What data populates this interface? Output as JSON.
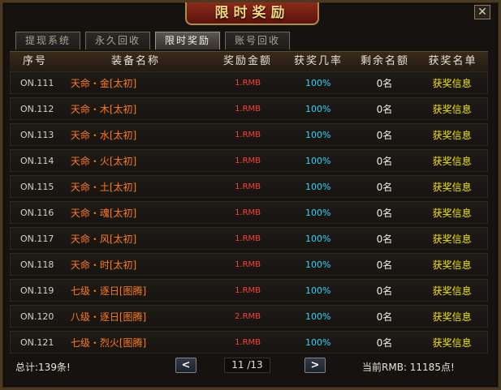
{
  "window": {
    "title": "限时奖励",
    "close_glyph": "✕"
  },
  "tabs": [
    {
      "label": "提现系统",
      "active": false
    },
    {
      "label": "永久回收",
      "active": false
    },
    {
      "label": "限时奖励",
      "active": true
    },
    {
      "label": "账号回收",
      "active": false
    }
  ],
  "table": {
    "headers": [
      "序号",
      "装备名称",
      "奖励金额",
      "获奖几率",
      "剩余名额",
      "获奖名单"
    ],
    "rows": [
      {
        "id": "ON.111",
        "name": "天命・金[太初]",
        "amount": "1.RMB",
        "rate": "100%",
        "remaining": "0名",
        "link": "获奖信息"
      },
      {
        "id": "ON.112",
        "name": "天命・木[太初]",
        "amount": "1.RMB",
        "rate": "100%",
        "remaining": "0名",
        "link": "获奖信息"
      },
      {
        "id": "ON.113",
        "name": "天命・水[太初]",
        "amount": "1.RMB",
        "rate": "100%",
        "remaining": "0名",
        "link": "获奖信息"
      },
      {
        "id": "ON.114",
        "name": "天命・火[太初]",
        "amount": "1.RMB",
        "rate": "100%",
        "remaining": "0名",
        "link": "获奖信息"
      },
      {
        "id": "ON.115",
        "name": "天命・土[太初]",
        "amount": "1.RMB",
        "rate": "100%",
        "remaining": "0名",
        "link": "获奖信息"
      },
      {
        "id": "ON.116",
        "name": "天命・魂[太初]",
        "amount": "1.RMB",
        "rate": "100%",
        "remaining": "0名",
        "link": "获奖信息"
      },
      {
        "id": "ON.117",
        "name": "天命・风[太初]",
        "amount": "1.RMB",
        "rate": "100%",
        "remaining": "0名",
        "link": "获奖信息"
      },
      {
        "id": "ON.118",
        "name": "天命・时[太初]",
        "amount": "1.RMB",
        "rate": "100%",
        "remaining": "0名",
        "link": "获奖信息"
      },
      {
        "id": "ON.119",
        "name": "七级・逐日[图腾]",
        "amount": "1.RMB",
        "rate": "100%",
        "remaining": "0名",
        "link": "获奖信息"
      },
      {
        "id": "ON.120",
        "name": "八级・逐日[图腾]",
        "amount": "2.RMB",
        "rate": "100%",
        "remaining": "0名",
        "link": "获奖信息"
      },
      {
        "id": "ON.121",
        "name": "七级・烈火[图腾]",
        "amount": "1.RMB",
        "rate": "100%",
        "remaining": "0名",
        "link": "获奖信息"
      }
    ]
  },
  "footer": {
    "total": "总计:139条!",
    "prev_glyph": "<",
    "next_glyph": ">",
    "page": "11 /13",
    "current_rmb": "当前RMB: 11185点!"
  }
}
